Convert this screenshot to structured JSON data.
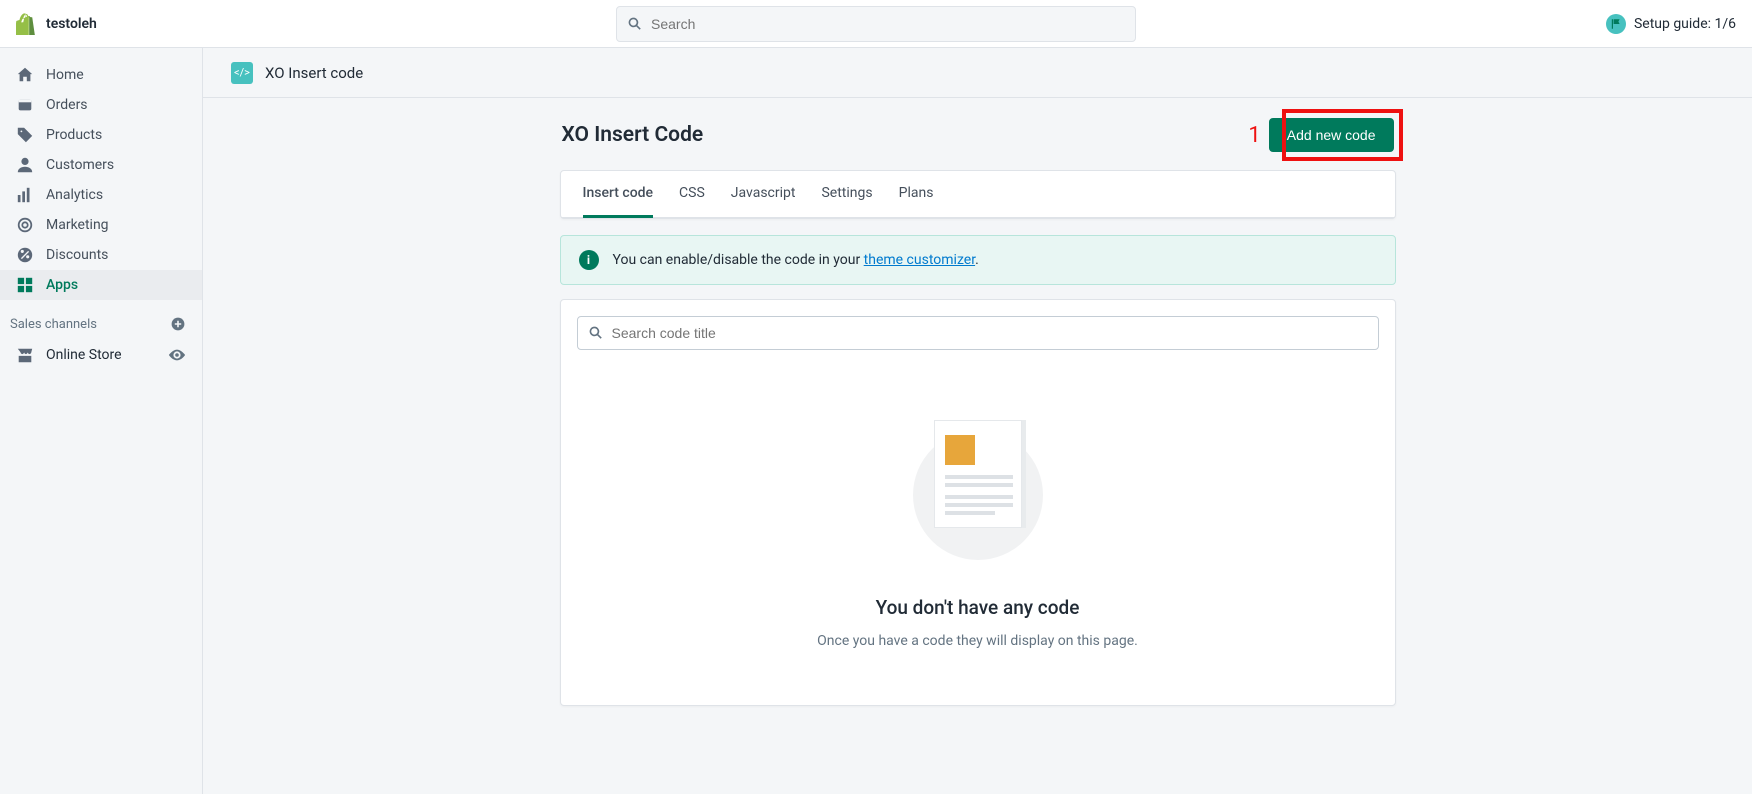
{
  "topbar": {
    "store_name": "testoleh",
    "search_placeholder": "Search",
    "setup_guide": "Setup guide: 1/6"
  },
  "sidebar": {
    "items": [
      {
        "label": "Home"
      },
      {
        "label": "Orders"
      },
      {
        "label": "Products"
      },
      {
        "label": "Customers"
      },
      {
        "label": "Analytics"
      },
      {
        "label": "Marketing"
      },
      {
        "label": "Discounts"
      },
      {
        "label": "Apps"
      }
    ],
    "sales_channels_label": "Sales channels",
    "online_store_label": "Online Store"
  },
  "app_header": {
    "name": "XO Insert code"
  },
  "page": {
    "title": "XO Insert Code",
    "add_btn": "Add new code",
    "annotation": "1",
    "tabs": [
      {
        "label": "Insert code",
        "active": true
      },
      {
        "label": "CSS"
      },
      {
        "label": "Javascript"
      },
      {
        "label": "Settings"
      },
      {
        "label": "Plans"
      }
    ],
    "info_text_prefix": "You can enable/disable the code in your ",
    "info_link": "theme customizer",
    "info_suffix": ".",
    "search_placeholder": "Search code title",
    "empty_heading": "You don't have any code",
    "empty_sub": "Once you have a code they will display on this page."
  }
}
